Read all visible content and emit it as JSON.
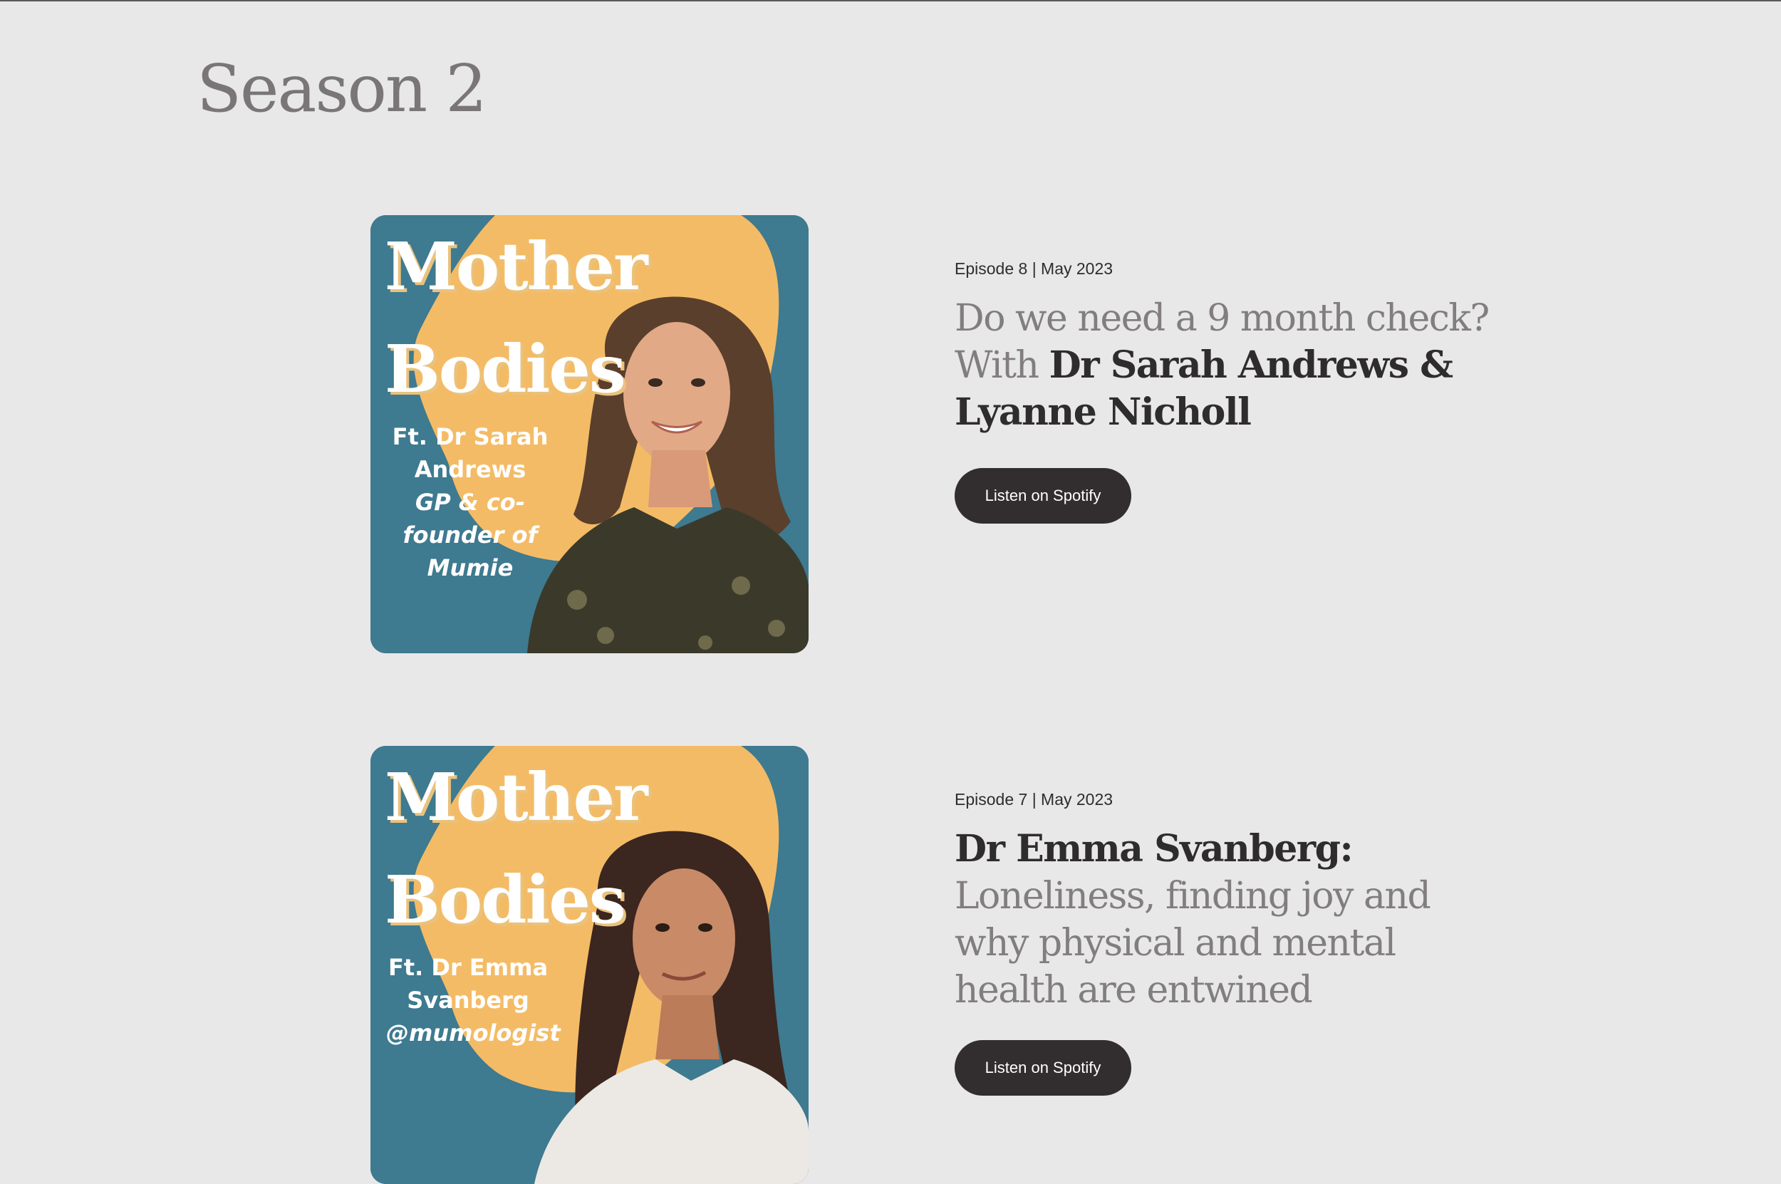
{
  "season": {
    "title": "Season 2"
  },
  "colors": {
    "background": "#e8e8e8",
    "cover_teal": "#3e7a90",
    "cover_blob": "#f4bb66",
    "button_bg": "#322e2f",
    "title_light": "#827e80",
    "title_dark": "#2f2c2d"
  },
  "episodes": [
    {
      "meta": "Episode 8 | May 2023",
      "title_light_1": "Do we need a 9 month check? With ",
      "title_bold_1": "Dr Sarah Andrews & Lyanne Nicholl",
      "button_label": "Listen on Spotify",
      "cover": {
        "word1": "Mother",
        "word2": "Bodies",
        "feat_line1": "Ft. Dr Sarah",
        "feat_line2": "Andrews",
        "feat_italic1": "GP & co-",
        "feat_italic2": "founder of",
        "feat_italic3": "Mumie"
      }
    },
    {
      "meta": "Episode 7 | May 2023",
      "title_bold_1": "Dr Emma Svanberg:",
      "title_light_1": "Loneliness, finding joy and why physical and mental health are entwined",
      "button_label": "Listen on Spotify",
      "cover": {
        "word1": "Mother",
        "word2": "Bodies",
        "feat_line1": "Ft. Dr Emma",
        "feat_line2": "Svanberg",
        "feat_italic1": "@mumologist"
      }
    }
  ]
}
